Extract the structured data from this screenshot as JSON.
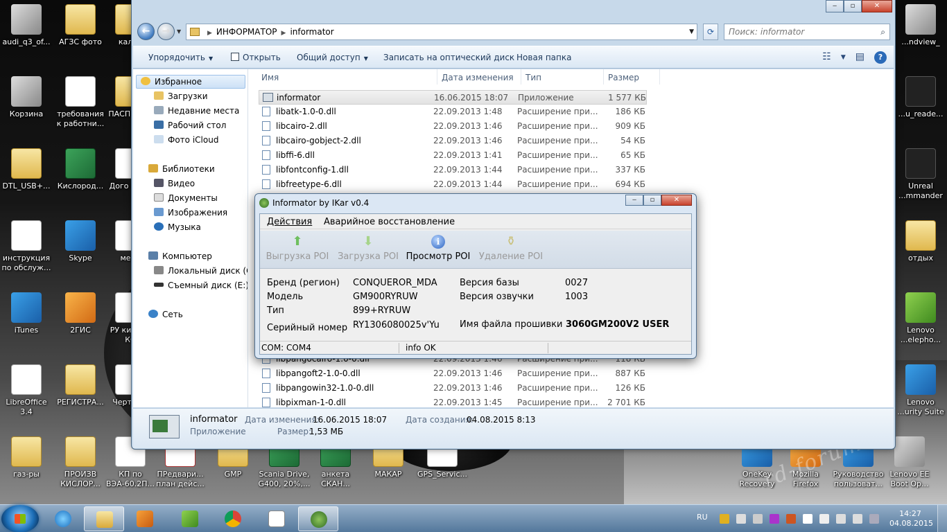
{
  "desktop": {
    "icons": [
      {
        "label": "audi_q3_of...",
        "kind": "ic-gray"
      },
      {
        "label": "АГЗС фото",
        "kind": "ic-folder"
      },
      {
        "label": "кален",
        "kind": "ic-folder"
      },
      {
        "label": "Корзина",
        "kind": "ic-gray"
      },
      {
        "label": "требования к работни...",
        "kind": "ic-doc"
      },
      {
        "label": "ПАСП СЕРГ",
        "kind": "ic-folder"
      },
      {
        "label": "DTL_USB+...",
        "kind": "ic-folder"
      },
      {
        "label": "Кислород...",
        "kind": "ic-excel"
      },
      {
        "label": "Дого найм",
        "kind": "ic-doc"
      },
      {
        "label": "инструкция по обслуж...",
        "kind": "ic-doc"
      },
      {
        "label": "Skype",
        "kind": "ic-blue"
      },
      {
        "label": "мене",
        "kind": "ic-doc"
      },
      {
        "label": "iTunes",
        "kind": "ic-blue"
      },
      {
        "label": "2ГИС",
        "kind": "ic-orange"
      },
      {
        "label": "РУ кис газ КС",
        "kind": "ic-doc"
      },
      {
        "label": "LibreOffice 3.4",
        "kind": "ic-doc"
      },
      {
        "label": "РЕГИСТРА...",
        "kind": "ic-folder"
      },
      {
        "label": "Черт Вес",
        "kind": "ic-doc"
      },
      {
        "label": "газ-ры",
        "kind": "ic-folder"
      },
      {
        "label": "ПРОИЗВ КИСЛОР...",
        "kind": "ic-folder"
      },
      {
        "label": "КП по ВЭА-60.2П...",
        "kind": "ic-doc"
      },
      {
        "label": "ПРедвари... план дейс...",
        "kind": "ic-pdf"
      },
      {
        "label": "GMP",
        "kind": "ic-folder"
      },
      {
        "label": "Scania Drive, G400, 20%,...",
        "kind": "ic-excel"
      },
      {
        "label": "анкета СКАН...",
        "kind": "ic-excel"
      },
      {
        "label": "МАКАР",
        "kind": "ic-folder"
      },
      {
        "label": "GPS_Servic...",
        "kind": "ic-doc"
      },
      {
        "label": "...ndview_",
        "kind": "ic-gray"
      },
      {
        "label": "...u_reade...",
        "kind": "ic-black"
      },
      {
        "label": "Unreal ...mmander",
        "kind": "ic-black"
      },
      {
        "label": "отдых",
        "kind": "ic-folder"
      },
      {
        "label": "Lenovo ...elephо...",
        "kind": "ic-green"
      },
      {
        "label": "Lenovo ...urity Suite",
        "kind": "ic-blue"
      },
      {
        "label": "OneKey Recovery",
        "kind": "ic-blue"
      },
      {
        "label": "Mozilla Firefox",
        "kind": "ic-orange"
      },
      {
        "label": "Руководство пользоват...",
        "kind": "ic-blue"
      },
      {
        "label": "Lenovo EE Boot Op...",
        "kind": "ic-gray"
      }
    ]
  },
  "explorer": {
    "breadcrumb": [
      "ИНФОРМАТОР",
      "informator"
    ],
    "search_placeholder": "Поиск: informator",
    "toolbar": {
      "organize": "Упорядочить",
      "open": "Открыть",
      "share": "Общий доступ",
      "burn": "Записать на оптический диск",
      "new_folder": "Новая папка"
    },
    "nav": {
      "favorites": "Избранное",
      "downloads": "Загрузки",
      "recent": "Недавние места",
      "desktop": "Рабочий стол",
      "icloud": "Фото iCloud",
      "libraries": "Библиотеки",
      "video": "Видео",
      "documents": "Документы",
      "images": "Изображения",
      "music": "Музыка",
      "computer": "Компьютер",
      "local_disk": "Локальный диск (C:",
      "removable": "Съемный диск (E:)",
      "network": "Сеть"
    },
    "columns": {
      "name": "Имя",
      "date": "Дата изменения",
      "type": "Тип",
      "size": "Размер"
    },
    "files_top": [
      {
        "name": "informator",
        "date": "16.06.2015 18:07",
        "type": "Приложение",
        "size": "1 577 КБ"
      },
      {
        "name": "libatk-1.0-0.dll",
        "date": "22.09.2013 1:48",
        "type": "Расширение при...",
        "size": "186 КБ"
      },
      {
        "name": "libcairo-2.dll",
        "date": "22.09.2013 1:46",
        "type": "Расширение при...",
        "size": "909 КБ"
      },
      {
        "name": "libcairo-gobject-2.dll",
        "date": "22.09.2013 1:46",
        "type": "Расширение при...",
        "size": "54 КБ"
      },
      {
        "name": "libffi-6.dll",
        "date": "22.09.2013 1:41",
        "type": "Расширение при...",
        "size": "65 КБ"
      },
      {
        "name": "libfontconfig-1.dll",
        "date": "22.09.2013 1:44",
        "type": "Расширение при...",
        "size": "337 КБ"
      },
      {
        "name": "libfreetype-6.dll",
        "date": "22.09.2013 1:44",
        "type": "Расширение при...",
        "size": "694 КБ"
      }
    ],
    "files_bottom": [
      {
        "name": "libpangocairo-1.0-0.dll",
        "date": "22.09.2013 1:46",
        "type": "Расширение при...",
        "size": "118 КБ"
      },
      {
        "name": "libpangoft2-1.0-0.dll",
        "date": "22.09.2013 1:46",
        "type": "Расширение при...",
        "size": "887 КБ"
      },
      {
        "name": "libpangowin32-1.0-0.dll",
        "date": "22.09.2013 1:46",
        "type": "Расширение при...",
        "size": "126 КБ"
      },
      {
        "name": "libpixman-1-0.dll",
        "date": "22.09.2013 1:45",
        "type": "Расширение при...",
        "size": "2 701 КБ"
      }
    ],
    "details": {
      "name": "informator",
      "type": "Приложение",
      "modified_label": "Дата изменения:",
      "modified": "16.06.2015 18:07",
      "created_label": "Дата создания:",
      "created": "04.08.2015 8:13",
      "size_label": "Размер:",
      "size": "1,53 МБ"
    }
  },
  "informator": {
    "title": "Informator by IKar v0.4",
    "menu": {
      "actions": "Действия",
      "recovery": "Аварийное восстановление"
    },
    "tools": {
      "upload": "Выгрузка POI",
      "download": "Загрузка POI",
      "view": "Просмотр POI",
      "delete": "Удаление POI"
    },
    "fields": {
      "brand_label": "Бренд (регион)",
      "brand": "CONQUEROR_MDA",
      "model_label": "Модель",
      "model": "GM900RYRUW",
      "type_label": "Тип",
      "type": "899+RYRUW",
      "serial_label": "Серийный номер",
      "serial": "RY1306080025v'Yu",
      "db_version_label": "Версия базы",
      "db_version": "0027",
      "voice_version_label": "Версия озвучки",
      "voice_version": "1003",
      "firmware_label": "Имя файла прошивки",
      "firmware": "3060GM200V2 USER"
    },
    "status": {
      "port": "COM: COM4",
      "info": "info OK"
    }
  },
  "taskbar": {
    "lang": "RU",
    "time": "14:27",
    "date": "04.08.2015"
  },
  "watermark": "rd-forum.ru"
}
